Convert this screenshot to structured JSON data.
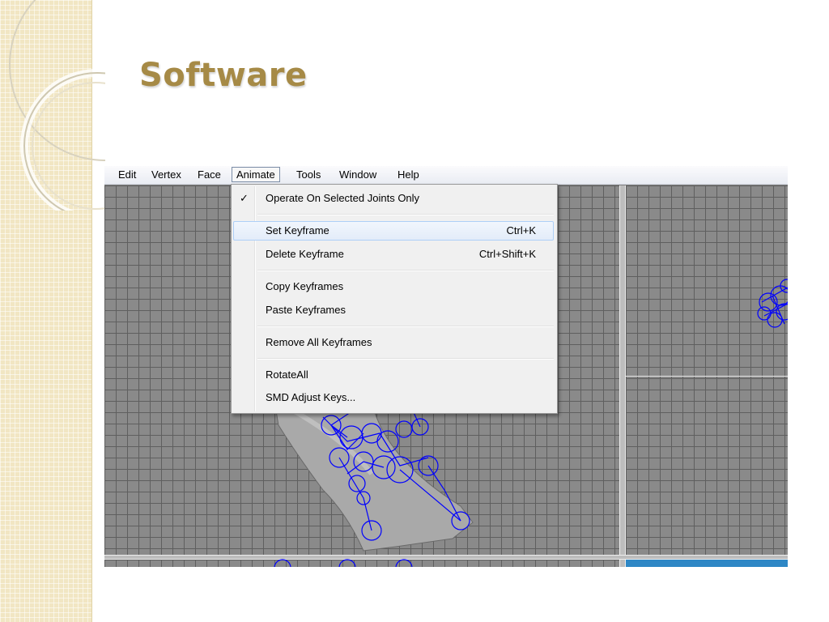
{
  "slide": {
    "title": "Software"
  },
  "menubar": {
    "items": [
      "Edit",
      "Vertex",
      "Face",
      "Animate",
      "Tools",
      "Window",
      "Help"
    ],
    "active": "Animate"
  },
  "animate_menu": {
    "items": [
      {
        "label": "Operate On Selected Joints Only",
        "shortcut": "",
        "checked": true
      },
      {
        "label": "Set Keyframe",
        "shortcut": "Ctrl+K",
        "highlighted": true
      },
      {
        "label": "Delete Keyframe",
        "shortcut": "Ctrl+Shift+K"
      },
      {
        "label": "Copy Keyframes",
        "shortcut": ""
      },
      {
        "label": "Paste Keyframes",
        "shortcut": ""
      },
      {
        "label": "Remove All Keyframes",
        "shortcut": ""
      },
      {
        "label": "RotateAll",
        "shortcut": ""
      },
      {
        "label": "SMD Adjust Keys...",
        "shortcut": ""
      }
    ],
    "check_glyph": "✓"
  },
  "colors": {
    "title": "#a68a46",
    "strip": "#f1e6c3",
    "joints": "#0000ff",
    "accent_bar": "#2e87c5"
  },
  "icons": [
    "checkmark-icon"
  ]
}
